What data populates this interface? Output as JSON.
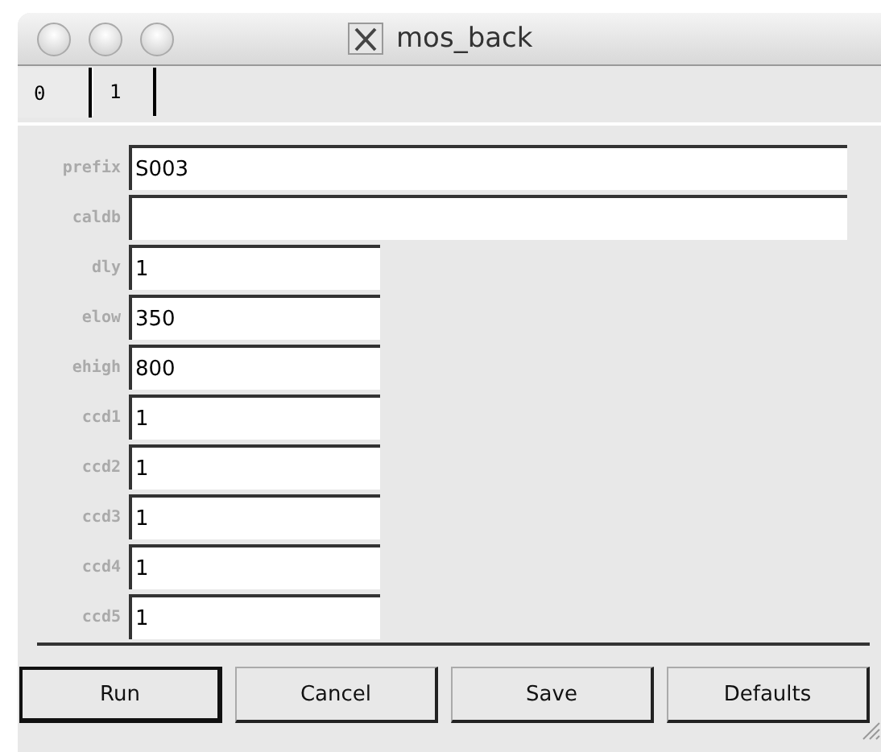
{
  "window": {
    "title": "mos_back"
  },
  "tabs": [
    {
      "label": "0",
      "selected": true
    },
    {
      "label": "1",
      "selected": false
    }
  ],
  "fields": [
    {
      "label": "prefix",
      "value": "S003",
      "kind": "wide"
    },
    {
      "label": "caldb",
      "kind": "wide"
    },
    {
      "label": "dly",
      "value": "1",
      "kind": "narrow"
    },
    {
      "label": "elow",
      "value": "350",
      "kind": "narrow"
    },
    {
      "label": "ehigh",
      "value": "800",
      "kind": "narrow"
    },
    {
      "label": "ccd1",
      "value": "1",
      "kind": "narrow"
    },
    {
      "label": "ccd2",
      "value": "1",
      "kind": "narrow"
    },
    {
      "label": "ccd3",
      "value": "1",
      "kind": "narrow"
    },
    {
      "label": "ccd4",
      "value": "1",
      "kind": "narrow"
    },
    {
      "label": "ccd5",
      "value": "1",
      "kind": "narrow"
    }
  ],
  "buttons": [
    {
      "label": "Run",
      "default": true
    },
    {
      "label": "Cancel",
      "default": false
    },
    {
      "label": "Save",
      "default": false
    },
    {
      "label": "Defaults",
      "default": false
    }
  ]
}
